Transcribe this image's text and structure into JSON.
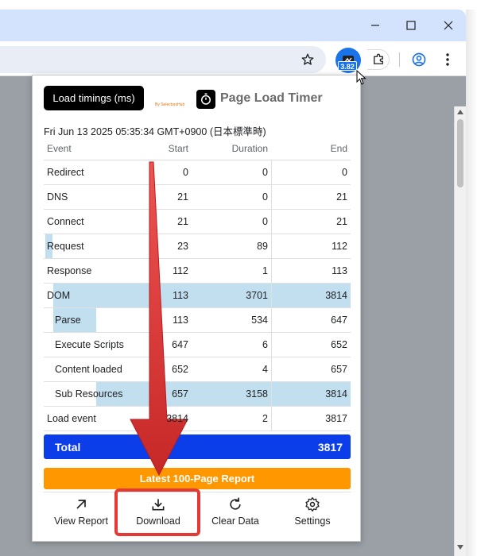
{
  "extension": {
    "badge": "3.82"
  },
  "popup": {
    "tab_label": "Load timings (ms)",
    "logo_title": "Page Load Timer",
    "logo_subtitle": "By SelectorsHub",
    "timestamp": "Fri Jun 13 2025 05:35:34 GMT+0900 (日本標準時)",
    "columns": [
      "Event",
      "Start",
      "Duration",
      "End"
    ],
    "rows": [
      {
        "event": "Redirect",
        "start": "0",
        "duration": "0",
        "end": "0",
        "indent": false,
        "bar_start": 0.0,
        "bar_end": 0.0
      },
      {
        "event": "DNS",
        "start": "21",
        "duration": "0",
        "end": "21",
        "indent": false,
        "bar_start": 0.0,
        "bar_end": 0.0
      },
      {
        "event": "Connect",
        "start": "21",
        "duration": "0",
        "end": "21",
        "indent": false,
        "bar_start": 0.0,
        "bar_end": 0.0
      },
      {
        "event": "Request",
        "start": "23",
        "duration": "89",
        "end": "112",
        "indent": false,
        "bar_start": 0.006,
        "bar_end": 0.029
      },
      {
        "event": "Response",
        "start": "112",
        "duration": "1",
        "end": "113",
        "indent": false,
        "bar_start": 0.029,
        "bar_end": 0.03
      },
      {
        "event": "DOM",
        "start": "113",
        "duration": "3701",
        "end": "3814",
        "indent": false,
        "bar_start": 0.03,
        "bar_end": 0.999
      },
      {
        "event": "Parse",
        "start": "113",
        "duration": "534",
        "end": "647",
        "indent": true,
        "bar_start": 0.03,
        "bar_end": 0.17
      },
      {
        "event": "Execute Scripts",
        "start": "647",
        "duration": "6",
        "end": "652",
        "indent": true,
        "bar_start": 0.17,
        "bar_end": 0.171
      },
      {
        "event": "Content loaded",
        "start": "652",
        "duration": "4",
        "end": "657",
        "indent": true,
        "bar_start": 0.171,
        "bar_end": 0.172
      },
      {
        "event": "Sub Resources",
        "start": "657",
        "duration": "3158",
        "end": "3814",
        "indent": true,
        "bar_start": 0.172,
        "bar_end": 0.999
      },
      {
        "event": "Load event",
        "start": "3814",
        "duration": "2",
        "end": "3817",
        "indent": false,
        "bar_start": 0.999,
        "bar_end": 1.0
      }
    ],
    "total_label": "Total",
    "total_value": "3817",
    "report_button": "Latest 100-Page Report",
    "footer": {
      "view_report": "View Report",
      "download": "Download",
      "clear_data": "Clear Data",
      "settings": "Settings"
    }
  },
  "colors": {
    "bar": "#c2dff0",
    "total_bg": "#0b3de8",
    "report_bg": "#ff9800",
    "highlight": "#e53935",
    "arrow": "#d32f2f"
  }
}
